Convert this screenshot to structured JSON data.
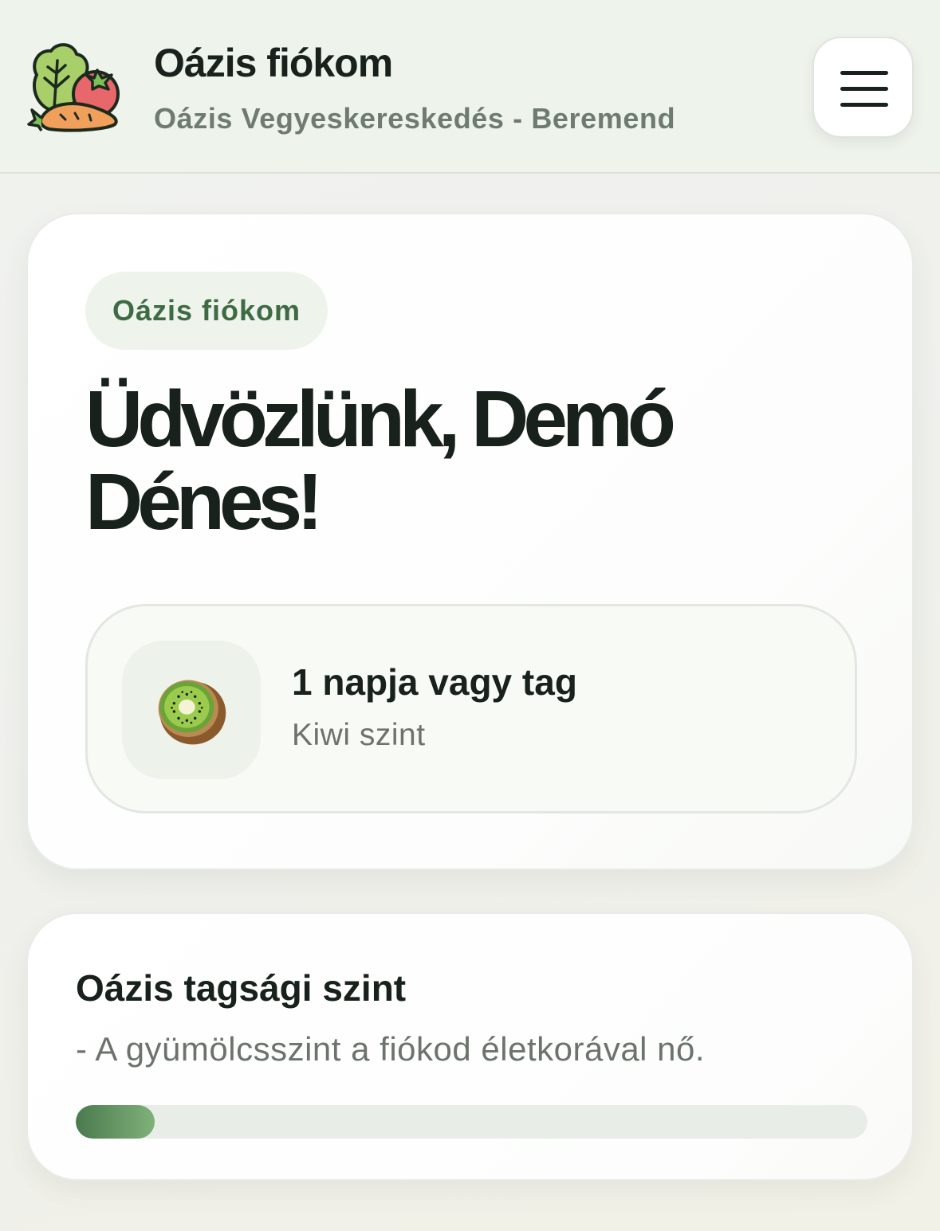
{
  "header": {
    "title": "Oázis fiókom",
    "subtitle": "Oázis Vegyeskereskedés - Beremend",
    "logo_icon": "vegetables-logo-icon",
    "menu_icon": "hamburger-menu-icon"
  },
  "welcome": {
    "badge": "Oázis fiókom",
    "greeting": "Üdvözlünk, Demó Dénes!",
    "membership": {
      "days_text": "1 napja vagy tag",
      "level_text": "Kiwi szint",
      "icon": "kiwi-icon"
    }
  },
  "tier": {
    "title": "Oázis tagsági szint",
    "description": "- A gyümölcsszint a fiókod életkorával nő.",
    "progress": 0.1
  },
  "colors": {
    "accent": "#3f6b44",
    "progress_start": "#4a7a4e",
    "progress_end": "#7fb179",
    "header_bg": "#eef3ec"
  }
}
